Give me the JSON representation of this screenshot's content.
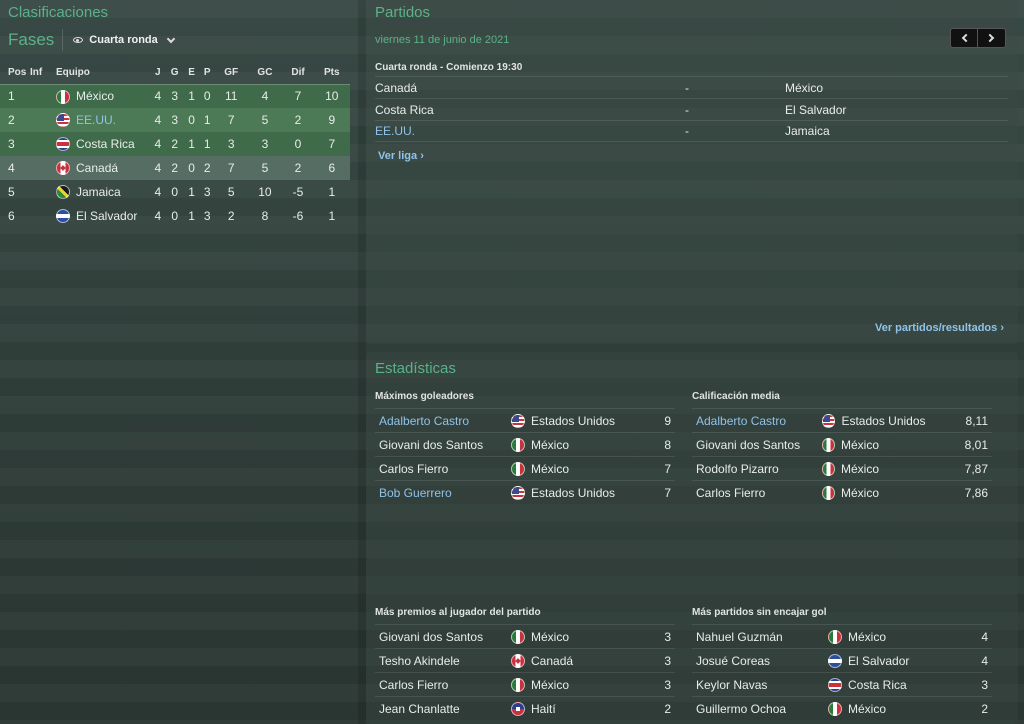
{
  "left": {
    "title": "Clasificaciones",
    "fases_label": "Fases",
    "fases_selected": "Cuarta ronda",
    "columns": [
      "Pos",
      "Inf",
      "Equipo",
      "J",
      "G",
      "E",
      "P",
      "GF",
      "GC",
      "Dif",
      "Pts"
    ],
    "rows": [
      {
        "pos": "1",
        "team": "México",
        "flag": "mexico-flag-icon",
        "j": "4",
        "g": "3",
        "e": "1",
        "p": "0",
        "gf": "11",
        "gc": "4",
        "dif": "7",
        "pts": "10"
      },
      {
        "pos": "2",
        "team": "EE.UU.",
        "flag": "usa-flag-icon",
        "j": "4",
        "g": "3",
        "e": "0",
        "p": "1",
        "gf": "7",
        "gc": "5",
        "dif": "2",
        "pts": "9"
      },
      {
        "pos": "3",
        "team": "Costa Rica",
        "flag": "costa-rica-flag-icon",
        "j": "4",
        "g": "2",
        "e": "1",
        "p": "1",
        "gf": "3",
        "gc": "3",
        "dif": "0",
        "pts": "7"
      },
      {
        "pos": "4",
        "team": "Canadá",
        "flag": "canada-flag-icon",
        "j": "4",
        "g": "2",
        "e": "0",
        "p": "2",
        "gf": "7",
        "gc": "5",
        "dif": "2",
        "pts": "6"
      },
      {
        "pos": "5",
        "team": "Jamaica",
        "flag": "jamaica-flag-icon",
        "j": "4",
        "g": "0",
        "e": "1",
        "p": "3",
        "gf": "5",
        "gc": "10",
        "dif": "-5",
        "pts": "1"
      },
      {
        "pos": "6",
        "team": "El Salvador",
        "flag": "el-salvador-flag-icon",
        "j": "4",
        "g": "0",
        "e": "1",
        "p": "3",
        "gf": "2",
        "gc": "8",
        "dif": "-6",
        "pts": "1"
      }
    ]
  },
  "partidos": {
    "title": "Partidos",
    "date": "viernes 11 de junio de 2021",
    "round_header": "Cuarta ronda - Comienzo 19:30",
    "fixtures": [
      {
        "home": "Canadá",
        "sep": "-",
        "away": "México"
      },
      {
        "home": "Costa Rica",
        "sep": "-",
        "away": "El Salvador"
      },
      {
        "home": "EE.UU.",
        "sep": "-",
        "away": "Jamaica"
      }
    ],
    "ver_liga": "Ver liga",
    "ver_partidos": "Ver partidos/resultados"
  },
  "stats": {
    "title": "Estadísticas",
    "top_scorers": {
      "header": "Máximos goleadores",
      "rows": [
        {
          "name": "Adalberto Castro",
          "country": "Estados Unidos",
          "value": "9"
        },
        {
          "name": "Giovani dos Santos",
          "country": "México",
          "value": "8"
        },
        {
          "name": "Carlos Fierro",
          "country": "México",
          "value": "7"
        },
        {
          "name": "Bob Guerrero",
          "country": "Estados Unidos",
          "value": "7"
        }
      ]
    },
    "avg_rating": {
      "header": "Calificación media",
      "rows": [
        {
          "name": "Adalberto Castro",
          "country": "Estados Unidos",
          "value": "8,11"
        },
        {
          "name": "Giovani dos Santos",
          "country": "México",
          "value": "8,01"
        },
        {
          "name": "Rodolfo Pizarro",
          "country": "México",
          "value": "7,87"
        },
        {
          "name": "Carlos Fierro",
          "country": "México",
          "value": "7,86"
        }
      ]
    },
    "motm": {
      "header": "Más premios al jugador del partido",
      "rows": [
        {
          "name": "Giovani dos Santos",
          "country": "México",
          "value": "3"
        },
        {
          "name": "Tesho Akindele",
          "country": "Canadá",
          "value": "3"
        },
        {
          "name": "Carlos Fierro",
          "country": "México",
          "value": "3"
        },
        {
          "name": "Jean Chanlatte",
          "country": "Haití",
          "value": "2"
        }
      ]
    },
    "clean_sheets": {
      "header": "Más partidos sin encajar gol",
      "rows": [
        {
          "name": "Nahuel Guzmán",
          "country": "México",
          "value": "4"
        },
        {
          "name": "Josué Coreas",
          "country": "El Salvador",
          "value": "4"
        },
        {
          "name": "Keylor Navas",
          "country": "Costa Rica",
          "value": "3"
        },
        {
          "name": "Guillermo Ochoa",
          "country": "México",
          "value": "2"
        }
      ]
    }
  }
}
